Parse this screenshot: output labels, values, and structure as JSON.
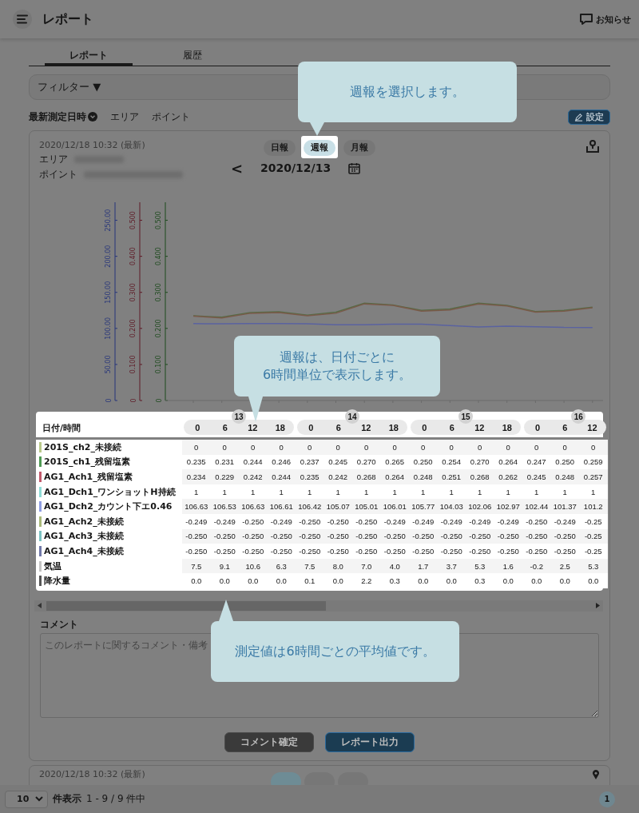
{
  "header": {
    "title": "レポート",
    "notice": "お知らせ"
  },
  "tabs": [
    {
      "label": "レポート",
      "selected": true
    },
    {
      "label": "履歴",
      "selected": false
    }
  ],
  "filter": {
    "label": "フィルター",
    "arrow": "▼"
  },
  "sort": [
    {
      "label": "最新測定日時",
      "selected": true
    },
    {
      "label": "エリア",
      "selected": false
    },
    {
      "label": "ポイント",
      "selected": false
    }
  ],
  "settings_button": "設定",
  "card": {
    "timestamp": "2020/12/18 10:32 (最新)",
    "area_label": "エリア",
    "point_label": "ポイント",
    "periods": [
      {
        "label": "日報",
        "selected": false
      },
      {
        "label": "週報",
        "selected": true
      },
      {
        "label": "月報",
        "selected": false
      }
    ],
    "prev": "<",
    "date": "2020/12/13",
    "chart_data": {
      "type": "line",
      "ylim": [
        0,
        0.55
      ],
      "y2lim": [
        0,
        0.55
      ],
      "y3lim": [
        0,
        275
      ],
      "yticks": [
        {
          "value": 0,
          "label": "0"
        },
        {
          "value": 0.1,
          "label": "0.100"
        },
        {
          "value": 0.2,
          "label": "0.200"
        },
        {
          "value": 0.3,
          "label": "0.300"
        },
        {
          "value": 0.4,
          "label": "0.400"
        },
        {
          "value": 0.5,
          "label": "0.500"
        }
      ],
      "y2ticks": [
        {
          "value": 0,
          "label": "0"
        },
        {
          "value": 0.1,
          "label": "0.100"
        },
        {
          "value": 0.2,
          "label": "0.200"
        },
        {
          "value": 0.3,
          "label": "0.300"
        },
        {
          "value": 0.4,
          "label": "0.400"
        },
        {
          "value": 0.5,
          "label": "0.500"
        }
      ],
      "y3ticks": [
        {
          "value": 0,
          "label": "0"
        },
        {
          "value": 50,
          "label": "50.00"
        },
        {
          "value": 100,
          "label": "100.00"
        },
        {
          "value": 150,
          "label": "150.00"
        },
        {
          "value": 200,
          "label": "200.00"
        },
        {
          "value": 250,
          "label": "250.00"
        }
      ],
      "series": [
        {
          "color": "#556b45",
          "values": [
            0.235,
            0.231,
            0.244,
            0.246,
            0.237,
            0.245,
            0.27,
            0.265,
            0.25,
            0.254,
            0.27,
            0.264,
            0.247,
            0.25,
            0.259
          ]
        },
        {
          "axis": "y2",
          "color": "#7a5a4a",
          "values": [
            0.234,
            0.229,
            0.242,
            0.244,
            0.235,
            0.242,
            0.268,
            0.264,
            0.248,
            0.251,
            0.268,
            0.262,
            0.245,
            0.248,
            0.257
          ]
        },
        {
          "axis": "y3",
          "color": "#5a62a0",
          "values": [
            106.6,
            106.5,
            106.6,
            106.6,
            106.4,
            105.1,
            105.0,
            106.0,
            105.8,
            104.0,
            102.1,
            103.0,
            102.4,
            101.4,
            101.3
          ]
        }
      ]
    },
    "table": {
      "corner": "日付/時間",
      "groups": [
        {
          "date": "13",
          "hours": [
            "0",
            "6",
            "12",
            "18"
          ]
        },
        {
          "date": "14",
          "hours": [
            "0",
            "6",
            "12",
            "18"
          ]
        },
        {
          "date": "15",
          "hours": [
            "0",
            "6",
            "12",
            "18"
          ]
        },
        {
          "date": "16",
          "hours": [
            "0",
            "6",
            "12"
          ]
        }
      ],
      "rows": [
        {
          "name": "201S_ch2_未接続",
          "color": "#b9c98a",
          "values": [
            "0",
            "0",
            "0",
            "0",
            "0",
            "0",
            "0",
            "0",
            "0",
            "0",
            "0",
            "0",
            "0",
            "0",
            "0"
          ]
        },
        {
          "name": "201S_ch1_残留塩素",
          "color": "#4f9a54",
          "values": [
            "0.235",
            "0.231",
            "0.244",
            "0.246",
            "0.237",
            "0.245",
            "0.270",
            "0.265",
            "0.250",
            "0.254",
            "0.270",
            "0.264",
            "0.247",
            "0.250",
            "0.259"
          ]
        },
        {
          "name": "AG1_Ach1_残留塩素",
          "color": "#c25a6c",
          "values": [
            "0.234",
            "0.229",
            "0.242",
            "0.244",
            "0.235",
            "0.242",
            "0.268",
            "0.264",
            "0.248",
            "0.251",
            "0.268",
            "0.262",
            "0.245",
            "0.248",
            "0.257"
          ]
        },
        {
          "name": "AG1_Dch1_ワンショットH持続",
          "color": "#8fdcd6",
          "values": [
            "1",
            "1",
            "1",
            "1",
            "1",
            "1",
            "1",
            "1",
            "1",
            "1",
            "1",
            "1",
            "1",
            "1",
            "1"
          ]
        },
        {
          "name": "AG1_Dch2_カウント下エ0.46",
          "color": "#8f9ee2",
          "values": [
            "106.63",
            "106.53",
            "106.63",
            "106.61",
            "106.42",
            "105.07",
            "105.01",
            "106.01",
            "105.77",
            "104.03",
            "102.06",
            "102.97",
            "102.44",
            "101.37",
            "101.2"
          ]
        },
        {
          "name": "AG1_Ach2_未接続",
          "color": "#a9b97a",
          "values": [
            "-0.249",
            "-0.249",
            "-0.250",
            "-0.249",
            "-0.250",
            "-0.250",
            "-0.250",
            "-0.249",
            "-0.249",
            "-0.249",
            "-0.249",
            "-0.249",
            "-0.250",
            "-0.249",
            "-0.25"
          ]
        },
        {
          "name": "AG1_Ach3_未接続",
          "color": "#7cc2c2",
          "values": [
            "-0.250",
            "-0.250",
            "-0.250",
            "-0.250",
            "-0.250",
            "-0.250",
            "-0.250",
            "-0.250",
            "-0.250",
            "-0.250",
            "-0.250",
            "-0.250",
            "-0.250",
            "-0.250",
            "-0.25"
          ]
        },
        {
          "name": "AG1_Ach4_未接続",
          "color": "#7078a8",
          "values": [
            "-0.250",
            "-0.250",
            "-0.250",
            "-0.250",
            "-0.250",
            "-0.250",
            "-0.250",
            "-0.250",
            "-0.250",
            "-0.250",
            "-0.250",
            "-0.250",
            "-0.250",
            "-0.250",
            "-0.25"
          ]
        },
        {
          "name": "気温",
          "color": "#c4c4c4",
          "values": [
            "7.5",
            "9.1",
            "10.6",
            "6.3",
            "7.5",
            "8.0",
            "7.0",
            "4.0",
            "1.7",
            "3.7",
            "5.3",
            "1.6",
            "-0.2",
            "2.5",
            "5.3"
          ]
        },
        {
          "name": "降水量",
          "color": "#555555",
          "values": [
            "0.0",
            "0.0",
            "0.0",
            "0.0",
            "0.1",
            "0.0",
            "2.2",
            "0.3",
            "0.0",
            "0.0",
            "0.3",
            "0.0",
            "0.0",
            "0.0",
            "0.0"
          ]
        }
      ]
    },
    "comment_label": "コメント",
    "comment_placeholder": "このレポートに関するコメント・備考",
    "buttons": [
      {
        "label": "コメント確定",
        "kind": "dark"
      },
      {
        "label": "レポート出力",
        "kind": "primary"
      }
    ]
  },
  "next_card": {
    "timestamp": "2020/12/18 10:32 (最新)",
    "periods": [
      {
        "selected": true
      },
      {
        "selected": false
      },
      {
        "selected": false
      }
    ]
  },
  "footer": {
    "page_size": "10",
    "per_page": "件表示",
    "range": "1 - 9 / 9 件中",
    "page": "1"
  },
  "callouts": [
    {
      "text": "週報を選択します。",
      "kind": "down"
    },
    {
      "text": "週報は、日付ごとに\n6時間単位で表示します。",
      "kind": "down"
    },
    {
      "text": "測定値は6時間ごとの平均値です。",
      "kind": "up"
    }
  ]
}
